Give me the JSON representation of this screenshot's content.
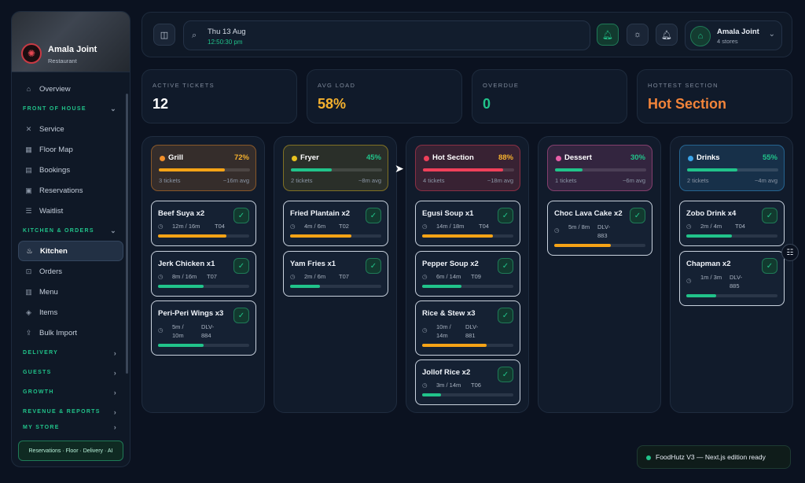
{
  "sidebar": {
    "brand": "Amala Joint",
    "brand_sub": "Restaurant",
    "overview": "Overview",
    "sections": [
      {
        "label": "FRONT OF HOUSE",
        "items": [
          "Service",
          "Floor Map",
          "Bookings",
          "Reservations",
          "Waitlist"
        ]
      },
      {
        "label": "KITCHEN & ORDERS",
        "items": [
          "Kitchen",
          "Orders",
          "Menu",
          "Items",
          "Bulk Import"
        ]
      }
    ],
    "collapsed": [
      "DELIVERY",
      "GUESTS",
      "GROWTH",
      "REVENUE & REPORTS",
      "MY STORE"
    ],
    "footer": "Reservations · Floor · Delivery · AI"
  },
  "topbar": {
    "date": "Thu 13 Aug",
    "time": "12:50:30 pm",
    "account_name": "Amala Joint",
    "account_sub": "4 stores"
  },
  "stats": [
    {
      "label": "ACTIVE TICKETS",
      "value": "12",
      "color": "#ffffff"
    },
    {
      "label": "AVG LOAD",
      "value": "58%",
      "color": "#f5b12e"
    },
    {
      "label": "OVERDUE",
      "value": "0",
      "color": "#21c38a"
    },
    {
      "label": "HOTTEST SECTION",
      "value": "Hot Section",
      "color": "#f2843a"
    }
  ],
  "columns": [
    {
      "name": "Grill",
      "pct": "72%",
      "load": 0.72,
      "color": "#f28f2a",
      "tickets": "3 tickets",
      "avg": "~16m avg",
      "items": [
        {
          "name": "Beef Suya x2",
          "time": "12m / 16m",
          "tag": "T04",
          "progress": 0.75,
          "bar": "#f5a316"
        },
        {
          "name": "Jerk Chicken x1",
          "time": "8m / 16m",
          "tag": "T07",
          "progress": 0.5,
          "bar": "#21c38a"
        },
        {
          "name": "Peri-Peri Wings x3",
          "time": "5m / 10m",
          "tag": "DLV-884",
          "progress": 0.5,
          "bar": "#21c38a"
        }
      ]
    },
    {
      "name": "Fryer",
      "pct": "45%",
      "load": 0.45,
      "color": "#e8c21f",
      "tickets": "2 tickets",
      "avg": "~8m avg",
      "items": [
        {
          "name": "Fried Plantain x2",
          "time": "4m / 6m",
          "tag": "T02",
          "progress": 0.67,
          "bar": "#f5a316"
        },
        {
          "name": "Yam Fries x1",
          "time": "2m / 6m",
          "tag": "T07",
          "progress": 0.33,
          "bar": "#21c38a"
        }
      ]
    },
    {
      "name": "Hot Section",
      "pct": "88%",
      "load": 0.88,
      "color": "#f0405a",
      "tickets": "4 tickets",
      "avg": "~18m avg",
      "items": [
        {
          "name": "Egusi Soup x1",
          "time": "14m / 18m",
          "tag": "T04",
          "progress": 0.78,
          "bar": "#f5a316"
        },
        {
          "name": "Pepper Soup x2",
          "time": "6m / 14m",
          "tag": "T09",
          "progress": 0.43,
          "bar": "#21c38a"
        },
        {
          "name": "Rice & Stew x3",
          "time": "10m / 14m",
          "tag": "DLV-881",
          "progress": 0.71,
          "bar": "#f5a316"
        },
        {
          "name": "Jollof Rice x2",
          "time": "3m / 14m",
          "tag": "T06",
          "progress": 0.21,
          "bar": "#21c38a"
        }
      ]
    },
    {
      "name": "Dessert",
      "pct": "30%",
      "load": 0.3,
      "color": "#e85fa8",
      "tickets": "1 tickets",
      "avg": "~6m avg",
      "items": [
        {
          "name": "Choc Lava Cake x2",
          "time": "5m / 8m",
          "tag": "DLV-883",
          "progress": 0.62,
          "bar": "#f5a316"
        }
      ]
    },
    {
      "name": "Drinks",
      "pct": "55%",
      "load": 0.55,
      "color": "#3aa3e8",
      "tickets": "2 tickets",
      "avg": "~4m avg",
      "items": [
        {
          "name": "Zobo Drink x4",
          "time": "2m / 4m",
          "tag": "T04",
          "progress": 0.5,
          "bar": "#21c38a"
        },
        {
          "name": "Chapman x2",
          "time": "1m / 3m",
          "tag": "DLV-885",
          "progress": 0.33,
          "bar": "#21c38a"
        }
      ]
    }
  ],
  "toast": "FoodHutz V3 — Next.js edition ready"
}
